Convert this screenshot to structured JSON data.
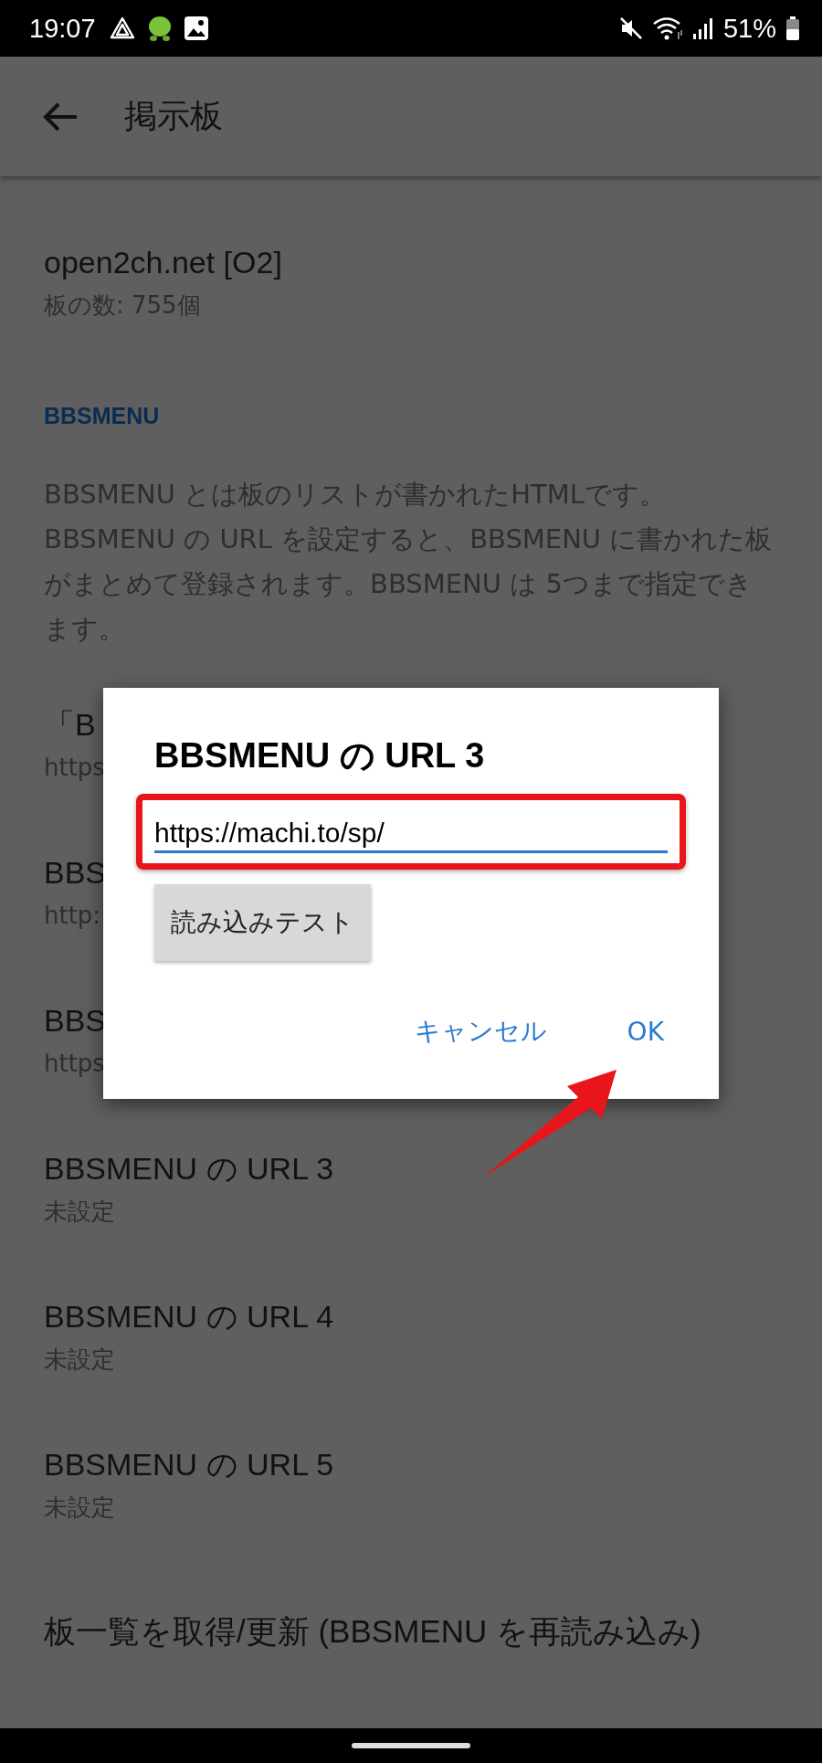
{
  "status_bar": {
    "time": "19:07",
    "battery": "51%"
  },
  "app_bar": {
    "title": "掲示板"
  },
  "board": {
    "name": "open2ch.net [O2]",
    "count": "板の数: 755個"
  },
  "section": {
    "header": "BBSMENU",
    "description": "BBSMENU とは板のリストが書かれたHTMLです。BBSMENU の URL を設定すると、BBSMENU に書かれた板がまとめて登録されます。BBSMENU は 5つまで指定できます。"
  },
  "items": [
    {
      "title": "「B",
      "subtitle": "https"
    },
    {
      "title": "BBS",
      "subtitle": "http:"
    },
    {
      "title": "BBS",
      "subtitle": "https"
    },
    {
      "title": "BBSMENU の URL 3",
      "subtitle": "未設定"
    },
    {
      "title": "BBSMENU の URL 4",
      "subtitle": "未設定"
    },
    {
      "title": "BBSMENU の URL 5",
      "subtitle": "未設定"
    },
    {
      "title": "板一覧を取得/更新 (BBSMENU を再読み込み)"
    }
  ],
  "dialog": {
    "title": "BBSMENU の URL 3",
    "value": "https://machi.to/sp/",
    "test_button": "読み込みテスト",
    "buttons": [
      "キャンセル",
      "OK"
    ]
  }
}
